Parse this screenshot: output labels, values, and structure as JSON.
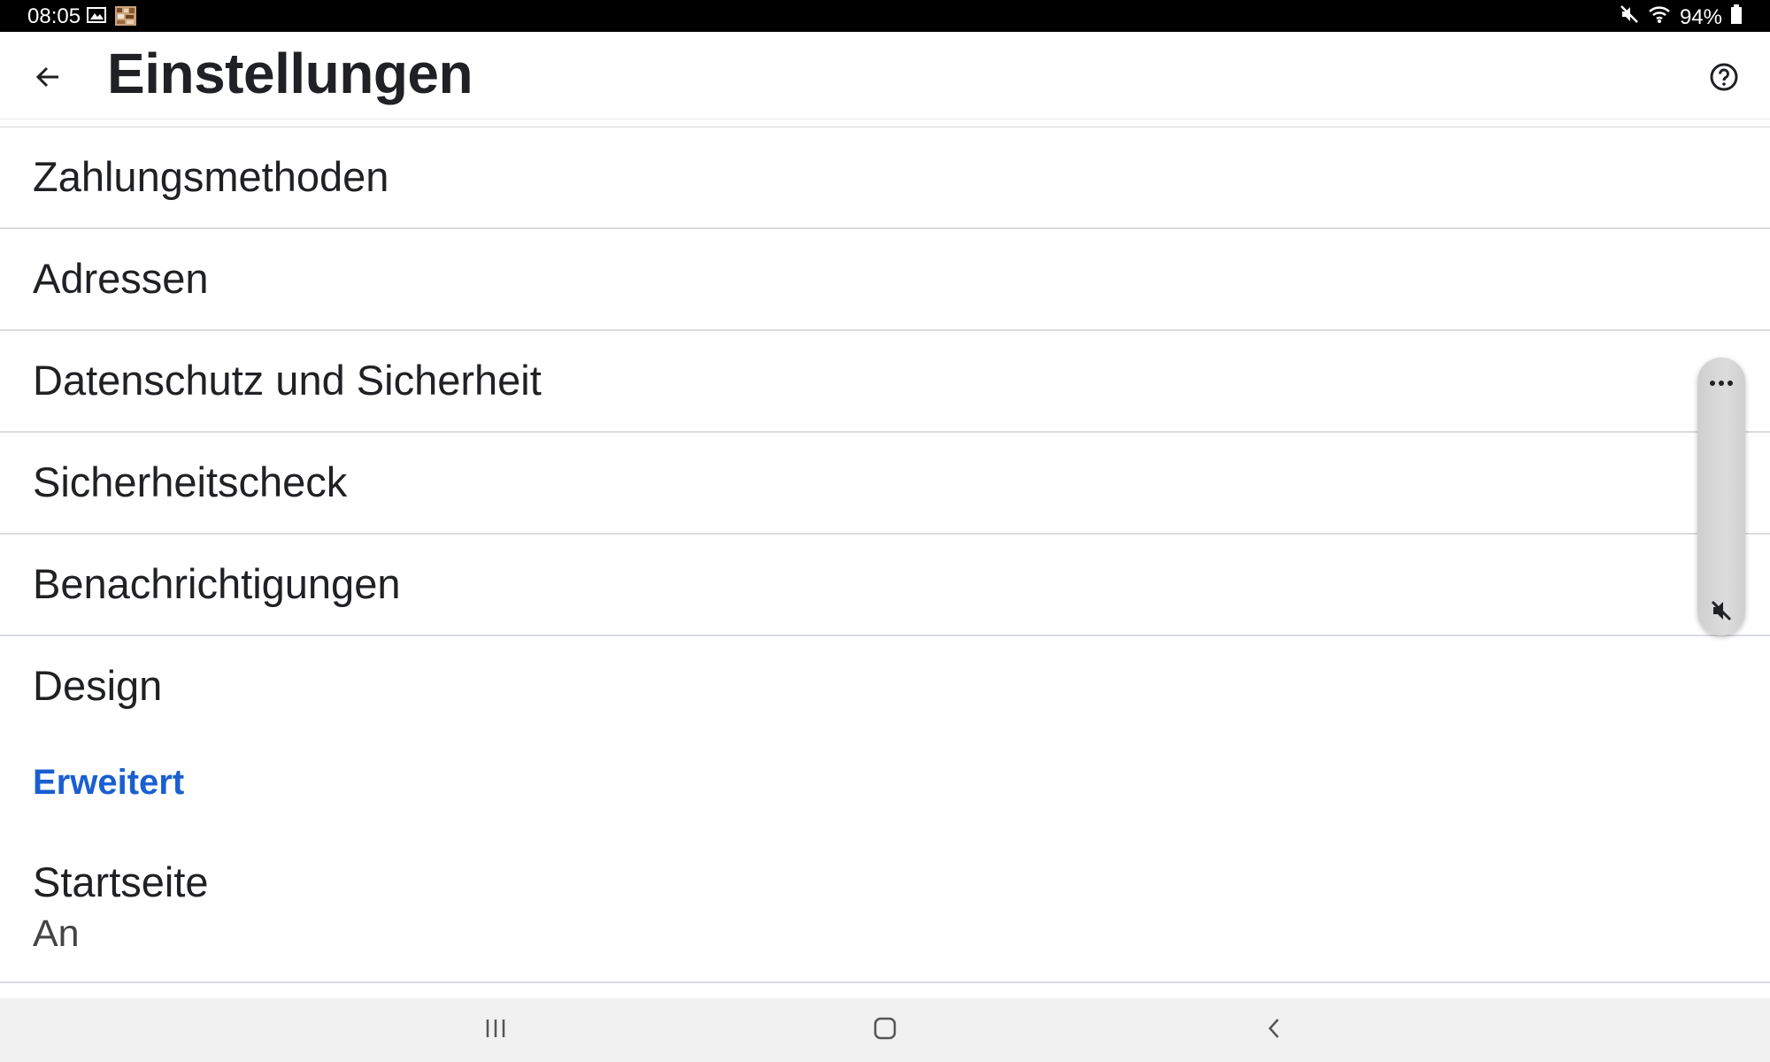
{
  "status_bar": {
    "time": "08:05",
    "battery": "94%",
    "icons": [
      "gallery-icon",
      "app-thumbnail-icon",
      "mute-icon",
      "wifi-icon",
      "battery-icon"
    ]
  },
  "toolbar": {
    "title": "Einstellungen",
    "back_icon": "arrow-back-icon",
    "help_icon": "help-circle-icon"
  },
  "settings": {
    "items": [
      {
        "label": "Zahlungsmethoden"
      },
      {
        "label": "Adressen"
      },
      {
        "label": "Datenschutz und Sicherheit"
      },
      {
        "label": "Sicherheitscheck"
      },
      {
        "label": "Benachrichtigungen"
      },
      {
        "label": "Design"
      }
    ],
    "section_header": "Erweitert",
    "startseite": {
      "title": "Startseite",
      "summary": "An"
    }
  },
  "side_panel": {
    "icons": [
      "more-horizontal-icon",
      "volume-off-icon"
    ]
  },
  "nav_bar": {
    "icons": [
      "recents-icon",
      "home-icon",
      "back-icon"
    ]
  },
  "colors": {
    "accent": "#1a5fd0",
    "text": "#202124",
    "divider": "#dadce0",
    "status_bar": "#000000",
    "nav_bar": "#f1f1f1"
  }
}
